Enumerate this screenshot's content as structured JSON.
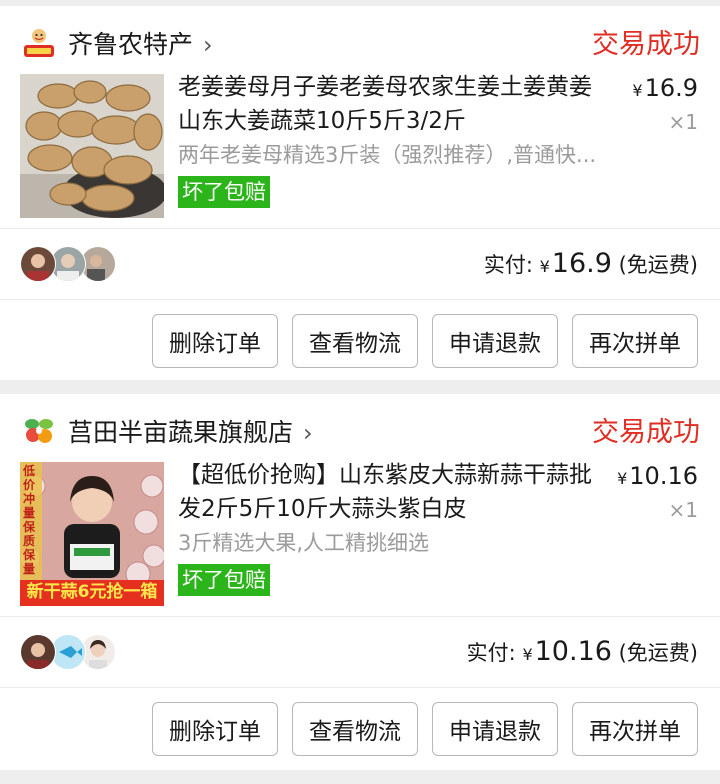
{
  "orders": [
    {
      "shop_name": "齐鲁农特产",
      "status": "交易成功",
      "product_title": "老姜姜母月子姜老姜母农家生姜土姜黄姜山东大姜蔬菜10斤5斤3/2斤",
      "spec": "两年老姜母精选3斤装（强烈推荐）,普通快...",
      "badge": "坏了包赔",
      "currency": "¥",
      "price": "16.9",
      "quantity": "×1",
      "paid_label": "实付:",
      "paid_amount": "16.9",
      "shipping": "(免运费)",
      "buttons": [
        "删除订单",
        "查看物流",
        "申请退款",
        "再次拼单"
      ]
    },
    {
      "shop_name": "莒田半亩蔬果旗舰店",
      "status": "交易成功",
      "product_title": "【超低价抢购】山东紫皮大蒜新蒜干蒜批发2斤5斤10斤大蒜头紫白皮",
      "spec": "3斤精选大果,人工精挑细选",
      "badge": "坏了包赔",
      "currency": "¥",
      "price": "10.16",
      "quantity": "×1",
      "paid_label": "实付:",
      "paid_amount": "10.16",
      "shipping": "(免运费)",
      "image_text_top": "低价冲量保质保量",
      "image_text_bottom": "新干蒜6元抢一箱",
      "buttons": [
        "删除订单",
        "查看物流",
        "申请退款",
        "再次拼单"
      ]
    }
  ]
}
